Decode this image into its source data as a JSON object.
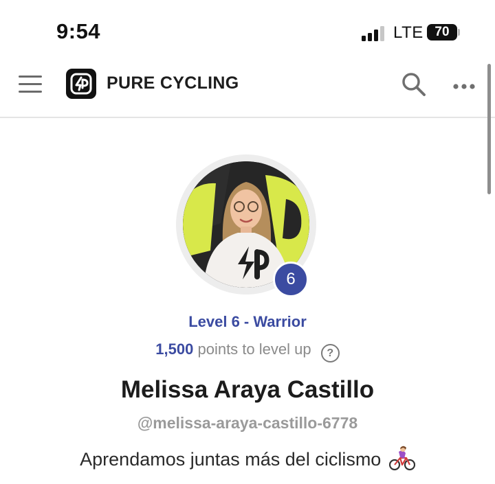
{
  "status_bar": {
    "time": "9:54",
    "network": "LTE",
    "battery": "70"
  },
  "header": {
    "brand": "PURE CYCLING",
    "icons": [
      "menu-icon",
      "logo",
      "search-icon",
      "more-icon"
    ]
  },
  "profile": {
    "level_number": "6",
    "level_label": "Level 6 - Warrior",
    "points": "1,500",
    "points_suffix": "points to level up",
    "help_glyph": "?",
    "name": "Melissa Araya Castillo",
    "handle": "@melissa-araya-castillo-6778",
    "bio": "Aprendamos juntas más del ciclismo",
    "bio_emoji": "woman-biking-emoji"
  },
  "colors": {
    "accent": "#3b4ba1",
    "brand_yellow": "#d8e84a",
    "text_primary": "#1c1c1c",
    "text_muted": "#9a9a9a"
  }
}
